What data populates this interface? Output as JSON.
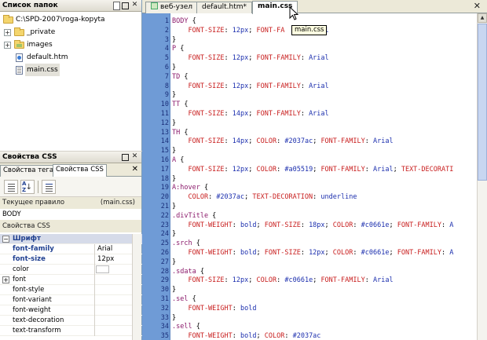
{
  "folders_panel": {
    "title": "Список папок",
    "tree": [
      {
        "label": "C:\\SPD-2007\\roga-kopyta",
        "kind": "root"
      },
      {
        "label": "_private",
        "kind": "folder-locked"
      },
      {
        "label": "images",
        "kind": "folder-images"
      },
      {
        "label": "default.htm",
        "kind": "file-htm"
      },
      {
        "label": "main.css",
        "kind": "file-css",
        "selected": true
      }
    ]
  },
  "css_panel": {
    "title": "Свойства CSS",
    "tabs": [
      "Свойства тега",
      "Свойства CSS"
    ],
    "current_rule_label": "Текущее правило",
    "current_rule_file": "(main.css)",
    "current_rule_value": "BODY",
    "props_header": "Свойства CSS",
    "properties": [
      {
        "name": "Шрифт",
        "value": "",
        "category": true
      },
      {
        "name": "font-family",
        "value": "Arial",
        "bold": true
      },
      {
        "name": "font-size",
        "value": "12px",
        "bold": true
      },
      {
        "name": "color",
        "value": "",
        "swatch": true
      },
      {
        "name": "font",
        "value": "",
        "expander": true
      },
      {
        "name": "font-style",
        "value": ""
      },
      {
        "name": "font-variant",
        "value": ""
      },
      {
        "name": "font-weight",
        "value": ""
      },
      {
        "name": "text-decoration",
        "value": ""
      },
      {
        "name": "text-transform",
        "value": ""
      }
    ]
  },
  "editor": {
    "tabs": [
      "веб-узел",
      "default.htm*",
      "main.css"
    ],
    "active_tab": 2,
    "tooltip": "main.css",
    "lines": [
      {
        "n": "1",
        "parts": [
          [
            "sel",
            "BODY"
          ],
          [
            "brace",
            " {"
          ]
        ]
      },
      {
        "n": "2",
        "parts": [
          [
            "prop",
            "    FONT-SIZE"
          ],
          [
            "brace",
            ": "
          ],
          [
            "val",
            "12px"
          ],
          [
            "brace",
            "; "
          ],
          [
            "prop",
            "FONT-FA"
          ],
          [
            "brace",
            "      "
          ],
          [
            "val",
            "Arial"
          ]
        ]
      },
      {
        "n": "3",
        "parts": [
          [
            "brace",
            "}"
          ]
        ]
      },
      {
        "n": "4",
        "parts": [
          [
            "sel",
            "P"
          ],
          [
            "brace",
            " {"
          ]
        ]
      },
      {
        "n": "5",
        "parts": [
          [
            "prop",
            "    FONT-SIZE"
          ],
          [
            "brace",
            ": "
          ],
          [
            "val",
            "12px"
          ],
          [
            "brace",
            "; "
          ],
          [
            "prop",
            "FONT-FAMILY"
          ],
          [
            "brace",
            ": "
          ],
          [
            "val",
            "Arial"
          ]
        ]
      },
      {
        "n": "6",
        "parts": [
          [
            "brace",
            "}"
          ]
        ]
      },
      {
        "n": "7",
        "parts": [
          [
            "sel",
            "TD"
          ],
          [
            "brace",
            " {"
          ]
        ]
      },
      {
        "n": "8",
        "parts": [
          [
            "prop",
            "    FONT-SIZE"
          ],
          [
            "brace",
            ": "
          ],
          [
            "val",
            "12px"
          ],
          [
            "brace",
            "; "
          ],
          [
            "prop",
            "FONT-FAMILY"
          ],
          [
            "brace",
            ": "
          ],
          [
            "val",
            "Arial"
          ]
        ]
      },
      {
        "n": "9",
        "parts": [
          [
            "brace",
            "}"
          ]
        ]
      },
      {
        "n": "10",
        "parts": [
          [
            "sel",
            "TT"
          ],
          [
            "brace",
            " {"
          ]
        ]
      },
      {
        "n": "11",
        "parts": [
          [
            "prop",
            "    FONT-SIZE"
          ],
          [
            "brace",
            ": "
          ],
          [
            "val",
            "14px"
          ],
          [
            "brace",
            "; "
          ],
          [
            "prop",
            "FONT-FAMILY"
          ],
          [
            "brace",
            ": "
          ],
          [
            "val",
            "Arial"
          ]
        ]
      },
      {
        "n": "12",
        "parts": [
          [
            "brace",
            "}"
          ]
        ]
      },
      {
        "n": "13",
        "parts": [
          [
            "sel",
            "TH"
          ],
          [
            "brace",
            " {"
          ]
        ]
      },
      {
        "n": "14",
        "parts": [
          [
            "prop",
            "    FONT-SIZE"
          ],
          [
            "brace",
            ": "
          ],
          [
            "val",
            "14px"
          ],
          [
            "brace",
            "; "
          ],
          [
            "prop",
            "COLOR"
          ],
          [
            "brace",
            ": "
          ],
          [
            "val",
            "#2037ac"
          ],
          [
            "brace",
            "; "
          ],
          [
            "prop",
            "FONT-FAMILY"
          ],
          [
            "brace",
            ": "
          ],
          [
            "val",
            "Arial"
          ]
        ]
      },
      {
        "n": "15",
        "parts": [
          [
            "brace",
            "}"
          ]
        ]
      },
      {
        "n": "16",
        "parts": [
          [
            "sel",
            "A"
          ],
          [
            "brace",
            " {"
          ]
        ]
      },
      {
        "n": "17",
        "parts": [
          [
            "prop",
            "    FONT-SIZE"
          ],
          [
            "brace",
            ": "
          ],
          [
            "val",
            "12px"
          ],
          [
            "brace",
            "; "
          ],
          [
            "prop",
            "COLOR"
          ],
          [
            "brace",
            ": "
          ],
          [
            "val",
            "#a05519"
          ],
          [
            "brace",
            "; "
          ],
          [
            "prop",
            "FONT-FAMILY"
          ],
          [
            "brace",
            ": "
          ],
          [
            "val",
            "Arial"
          ],
          [
            "brace",
            "; "
          ],
          [
            "prop",
            "TEXT-DECORATI"
          ]
        ]
      },
      {
        "n": "18",
        "parts": [
          [
            "brace",
            "}"
          ]
        ]
      },
      {
        "n": "19",
        "parts": [
          [
            "sel",
            "A:hover"
          ],
          [
            "brace",
            " {"
          ]
        ]
      },
      {
        "n": "20",
        "parts": [
          [
            "prop",
            "    COLOR"
          ],
          [
            "brace",
            ": "
          ],
          [
            "val",
            "#2037ac"
          ],
          [
            "brace",
            "; "
          ],
          [
            "prop",
            "TEXT-DECORATION"
          ],
          [
            "brace",
            ": "
          ],
          [
            "val",
            "underline"
          ]
        ]
      },
      {
        "n": "21",
        "parts": [
          [
            "brace",
            "}"
          ]
        ]
      },
      {
        "n": "22",
        "parts": [
          [
            "sel",
            ".divTitle"
          ],
          [
            "brace",
            " {"
          ]
        ]
      },
      {
        "n": "23",
        "parts": [
          [
            "prop",
            "    FONT-WEIGHT"
          ],
          [
            "brace",
            ": "
          ],
          [
            "val",
            "bold"
          ],
          [
            "brace",
            "; "
          ],
          [
            "prop",
            "FONT-SIZE"
          ],
          [
            "brace",
            ": "
          ],
          [
            "val",
            "18px"
          ],
          [
            "brace",
            "; "
          ],
          [
            "prop",
            "COLOR"
          ],
          [
            "brace",
            ": "
          ],
          [
            "val",
            "#c0661e"
          ],
          [
            "brace",
            "; "
          ],
          [
            "prop",
            "FONT-FAMILY"
          ],
          [
            "brace",
            ": "
          ],
          [
            "val",
            "A"
          ]
        ]
      },
      {
        "n": "24",
        "parts": [
          [
            "brace",
            "}"
          ]
        ]
      },
      {
        "n": "25",
        "parts": [
          [
            "sel",
            ".srch"
          ],
          [
            "brace",
            " {"
          ]
        ]
      },
      {
        "n": "26",
        "parts": [
          [
            "prop",
            "    FONT-WEIGHT"
          ],
          [
            "brace",
            ": "
          ],
          [
            "val",
            "bold"
          ],
          [
            "brace",
            "; "
          ],
          [
            "prop",
            "FONT-SIZE"
          ],
          [
            "brace",
            ": "
          ],
          [
            "val",
            "12px"
          ],
          [
            "brace",
            "; "
          ],
          [
            "prop",
            "COLOR"
          ],
          [
            "brace",
            ": "
          ],
          [
            "val",
            "#c0661e"
          ],
          [
            "brace",
            "; "
          ],
          [
            "prop",
            "FONT-FAMILY"
          ],
          [
            "brace",
            ": "
          ],
          [
            "val",
            "A"
          ]
        ]
      },
      {
        "n": "27",
        "parts": [
          [
            "brace",
            "}"
          ]
        ]
      },
      {
        "n": "28",
        "parts": [
          [
            "sel",
            ".sdata"
          ],
          [
            "brace",
            " {"
          ]
        ]
      },
      {
        "n": "29",
        "parts": [
          [
            "prop",
            "    FONT-SIZE"
          ],
          [
            "brace",
            ": "
          ],
          [
            "val",
            "12px"
          ],
          [
            "brace",
            "; "
          ],
          [
            "prop",
            "COLOR"
          ],
          [
            "brace",
            ": "
          ],
          [
            "val",
            "#c0661e"
          ],
          [
            "brace",
            "; "
          ],
          [
            "prop",
            "FONT-FAMILY"
          ],
          [
            "brace",
            ": "
          ],
          [
            "val",
            "Arial"
          ]
        ]
      },
      {
        "n": "30",
        "parts": [
          [
            "brace",
            "}"
          ]
        ]
      },
      {
        "n": "31",
        "parts": [
          [
            "sel",
            ".sel"
          ],
          [
            "brace",
            " {"
          ]
        ]
      },
      {
        "n": "32",
        "parts": [
          [
            "prop",
            "    FONT-WEIGHT"
          ],
          [
            "brace",
            ": "
          ],
          [
            "val",
            "bold"
          ]
        ]
      },
      {
        "n": "33",
        "parts": [
          [
            "brace",
            "}"
          ]
        ]
      },
      {
        "n": "34",
        "parts": [
          [
            "sel",
            ".sell"
          ],
          [
            "brace",
            " {"
          ]
        ]
      },
      {
        "n": "35",
        "parts": [
          [
            "prop",
            "    FONT-WEIGHT"
          ],
          [
            "brace",
            ": "
          ],
          [
            "val",
            "bold"
          ],
          [
            "brace",
            "; "
          ],
          [
            "prop",
            "COLOR"
          ],
          [
            "brace",
            ": "
          ],
          [
            "val",
            "#2037ac"
          ]
        ]
      }
    ]
  }
}
